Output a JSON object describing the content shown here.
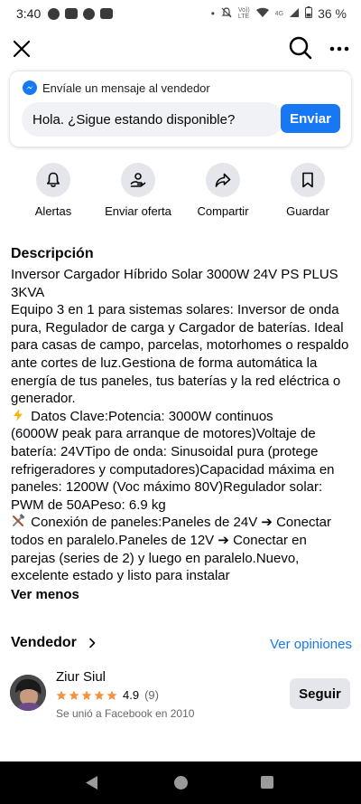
{
  "status_bar": {
    "time": "3:40",
    "signal_text": "Vo))\nLTE",
    "network": "4G",
    "battery": "36 %"
  },
  "message": {
    "header": "Envíale un mensaje al vendedor",
    "input_value": "Hola. ¿Sigue estando disponible?",
    "send_label": "Enviar"
  },
  "actions": [
    {
      "label": "Alertas",
      "icon": "bell-icon"
    },
    {
      "label": "Enviar oferta",
      "icon": "offer-icon"
    },
    {
      "label": "Compartir",
      "icon": "share-icon"
    },
    {
      "label": "Guardar",
      "icon": "bookmark-icon"
    }
  ],
  "description": {
    "title": "Descripción",
    "lines": [
      "Inversor Cargador Híbrido Solar 3000W 24V PS PLUS",
      "3KVA",
      "Equipo 3 en 1 para sistemas solares: Inversor de onda",
      "pura, Regulador de carga y Cargador de baterías. Ideal",
      "para casas de campo, parcelas, motorhomes o respaldo",
      "ante cortes de luz.Gestiona de forma automática la",
      "energía de tus paneles, tus baterías y la red eléctrica o",
      "generador.",
      "Datos Clave:Potencia: 3000W continuos",
      "(6000W peak para arranque de motores)Voltaje de",
      "batería: 24VTipo de onda: Sinusoidal pura (protege",
      "refrigeradores y computadores)Capacidad máxima en",
      "paneles: 1200W (Voc máximo 80V)Regulador solar:",
      "PWM de 50APeso: 6.9 kg",
      "Conexión de paneles:Paneles de 24V ➔ Conectar",
      "todos en paralelo.Paneles de 12V ➔ Conectar en",
      "parejas (series de 2) y luego en paralelo.Nuevo,",
      "excelente estado y listo para instalar"
    ],
    "see_less": "Ver menos"
  },
  "seller": {
    "section_title": "Vendedor",
    "reviews_link": "Ver opiniones",
    "name": "Ziur Siul",
    "rating": "4.9",
    "rating_count": "(9)",
    "stars": 5,
    "joined": "Se unió a Facebook en 2010",
    "follow_label": "Seguir"
  },
  "colors": {
    "accent": "#1877f2",
    "button_gray": "#e4e6eb",
    "star": "#f7923b",
    "muted_text": "#65676b"
  }
}
